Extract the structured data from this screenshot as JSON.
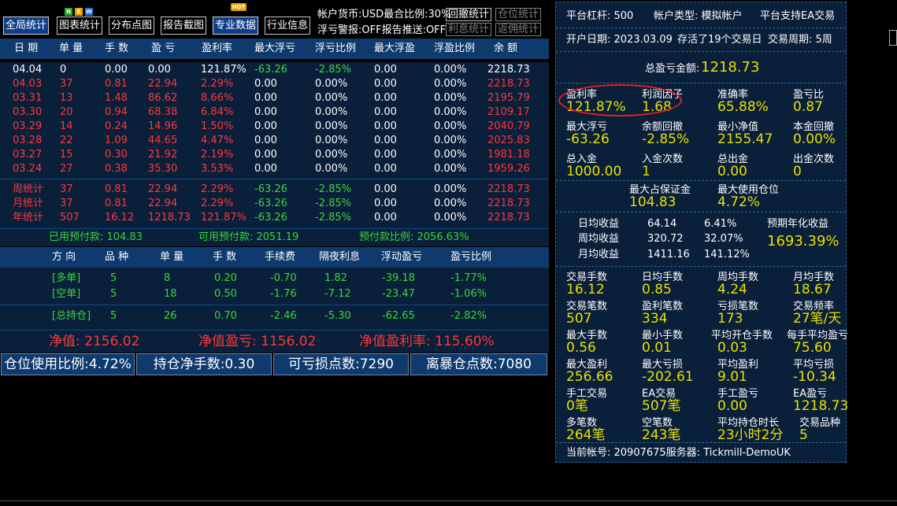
{
  "toolbar": {
    "buttons": [
      {
        "label": "全局统计"
      },
      {
        "label": "图表统计",
        "badge": "NEW"
      },
      {
        "label": "分布点图"
      },
      {
        "label": "报告截图"
      },
      {
        "label": "专业数据",
        "badge": "HOT"
      },
      {
        "label": "行业信息"
      }
    ],
    "info1": "帐户货币:USD最合比例:30%",
    "info2": "浮亏警报:OFF报告推送:OFF",
    "small_buttons": [
      "回撤统计",
      "仓位统计",
      "利息统计",
      "返佣统计"
    ],
    "badge_new_letters": [
      "N",
      "E",
      "W"
    ],
    "badge_hot": "HOT"
  },
  "history": {
    "headers": [
      "日 期",
      "单 量",
      "手 数",
      "盈 亏",
      "盈利率",
      "最大浮亏",
      "浮亏比例",
      "最大浮盈",
      "浮盈比例",
      "余 额"
    ],
    "rows": [
      [
        "04.04",
        "0",
        "0.00",
        "0.00",
        "121.87%",
        "-63.26",
        "-2.85%",
        "0.00",
        "0.00%",
        "2218.73"
      ],
      [
        "04.03",
        "37",
        "0.81",
        "22.94",
        "2.29%",
        "0.00",
        "0.00%",
        "0.00",
        "0.00%",
        "2218.73"
      ],
      [
        "03.31",
        "13",
        "1.48",
        "86.62",
        "8.66%",
        "0.00",
        "0.00%",
        "0.00",
        "0.00%",
        "2195.79"
      ],
      [
        "03.30",
        "20",
        "0.94",
        "68.38",
        "6.84%",
        "0.00",
        "0.00%",
        "0.00",
        "0.00%",
        "2109.17"
      ],
      [
        "03.29",
        "14",
        "0.24",
        "14.96",
        "1.50%",
        "0.00",
        "0.00%",
        "0.00",
        "0.00%",
        "2040.79"
      ],
      [
        "03.28",
        "22",
        "1.09",
        "44.65",
        "4.47%",
        "0.00",
        "0.00%",
        "0.00",
        "0.00%",
        "2025.83"
      ],
      [
        "03.27",
        "15",
        "0.30",
        "21.92",
        "2.19%",
        "0.00",
        "0.00%",
        "0.00",
        "0.00%",
        "1981.18"
      ],
      [
        "03.24",
        "27",
        "0.38",
        "35.30",
        "3.53%",
        "0.00",
        "0.00%",
        "0.00",
        "0.00%",
        "1959.26"
      ]
    ],
    "summary": [
      [
        "周统计",
        "37",
        "0.81",
        "22.94",
        "2.29%",
        "-63.26",
        "-2.85%",
        "0.00",
        "0.00%",
        "2218.73"
      ],
      [
        "月统计",
        "37",
        "0.81",
        "22.94",
        "2.29%",
        "-63.26",
        "-2.85%",
        "0.00",
        "0.00%",
        "2218.73"
      ],
      [
        "年统计",
        "507",
        "16.12",
        "1218.73",
        "121.87%",
        "-63.26",
        "-2.85%",
        "0.00",
        "0.00%",
        "2218.73"
      ]
    ]
  },
  "advance": {
    "used": "已用预付款: 104.83",
    "available": "可用预付款: 2051.19",
    "ratio": "预付款比例: 2056.63%"
  },
  "positions": {
    "headers": [
      "方 向",
      "品 种",
      "单 量",
      "手 数",
      "手续费",
      "隔夜利息",
      "浮动盈亏",
      "盈亏比例"
    ],
    "rows": [
      [
        "[多单]",
        "5",
        "8",
        "0.20",
        "-0.70",
        "1.82",
        "-39.18",
        "-1.77%"
      ],
      [
        "[空单]",
        "5",
        "18",
        "0.50",
        "-1.76",
        "-7.12",
        "-23.47",
        "-1.06%"
      ]
    ],
    "total": [
      "[总持仓]",
      "5",
      "26",
      "0.70",
      "-2.46",
      "-5.30",
      "-62.65",
      "-2.82%"
    ]
  },
  "net": {
    "value": "净值:  2156.02",
    "profit": "净值盈亏:  1156.02",
    "rate": "净值盈利率:  115.60%"
  },
  "stats_bar": [
    "仓位使用比例:4.72%",
    "持仓净手数:0.30",
    "可亏损点数:7290",
    "离暴仓点数:7080"
  ],
  "account": {
    "line1": [
      "平台杠杆:  500",
      "帐户类型:  模拟帐户",
      "平台支持EA交易"
    ],
    "line2": [
      "开户日期:  2023.03.09",
      "存活了19个交易日",
      "交易周期:  5周"
    ],
    "total_label": "总盈亏金额:",
    "total_value": "1218.73",
    "grid1": [
      {
        "label": "盈利率",
        "value": "121.87%"
      },
      {
        "label": "利润因子",
        "value": "1.68"
      },
      {
        "label": "准确率",
        "value": "65.88%"
      },
      {
        "label": "盈亏比",
        "value": "0.87"
      },
      {
        "label": "最大浮亏",
        "value": "-63.26"
      },
      {
        "label": "余额回撤",
        "value": "-2.85%"
      },
      {
        "label": "最小净值",
        "value": "2155.47"
      },
      {
        "label": "本金回撤",
        "value": "0.00%"
      },
      {
        "label": "总入金",
        "value": "1000.00"
      },
      {
        "label": "入金次数",
        "value": "1"
      },
      {
        "label": "总出金",
        "value": "0.00"
      },
      {
        "label": "出金次数",
        "value": "0"
      }
    ],
    "margin": [
      {
        "label": "最大占保证金",
        "value": "104.83"
      },
      {
        "label": "最大使用仓位",
        "value": "4.72%"
      }
    ],
    "income": [
      [
        "日均收益",
        "64.14",
        "6.41%"
      ],
      [
        "周均收益",
        "320.72",
        "32.07%"
      ],
      [
        "月均收益",
        "1411.16",
        "141.12%"
      ]
    ],
    "annual_label": "预期年化收益",
    "annual_value": "1693.39%",
    "grid2": [
      {
        "label": "交易手数",
        "value": "16.12"
      },
      {
        "label": "日均手数",
        "value": "0.85"
      },
      {
        "label": "周均手数",
        "value": "4.24"
      },
      {
        "label": "月均手数",
        "value": "18.67"
      },
      {
        "label": "交易笔数",
        "value": "507"
      },
      {
        "label": "盈利笔数",
        "value": "334"
      },
      {
        "label": "亏损笔数",
        "value": "173"
      },
      {
        "label": "交易频率",
        "value": "27笔/天"
      },
      {
        "label": "最大手数",
        "value": "0.56"
      },
      {
        "label": "最小手数",
        "value": "0.01"
      },
      {
        "label": "平均开仓手数",
        "value": "0.03"
      },
      {
        "label": "每手平均盈亏",
        "value": "75.60"
      },
      {
        "label": "最大盈利",
        "value": "256.66"
      },
      {
        "label": "最大亏损",
        "value": "-202.61"
      },
      {
        "label": "平均盈利",
        "value": "9.01"
      },
      {
        "label": "平均亏损",
        "value": "-10.34"
      },
      {
        "label": "手工交易",
        "value": "0笔"
      },
      {
        "label": "EA交易",
        "value": "507笔"
      },
      {
        "label": "手工盈亏",
        "value": "0.00"
      },
      {
        "label": "EA盈亏",
        "value": "1218.73"
      },
      {
        "label": "多笔数",
        "value": "264笔"
      },
      {
        "label": "空笔数",
        "value": "243笔"
      },
      {
        "label": "平均持仓时长",
        "value": "23小时2分"
      },
      {
        "label": "交易品种",
        "value": "5"
      }
    ],
    "footer": "当前帐号:  20907675服务器:  Tickmill-DemoUK"
  },
  "colors": {
    "header_bg": "#0f3a6d",
    "panel_bg": "#0a1f3a",
    "profit_red": "#ff3838",
    "loss_green": "#38d838",
    "value_yellow": "#e8e000"
  }
}
